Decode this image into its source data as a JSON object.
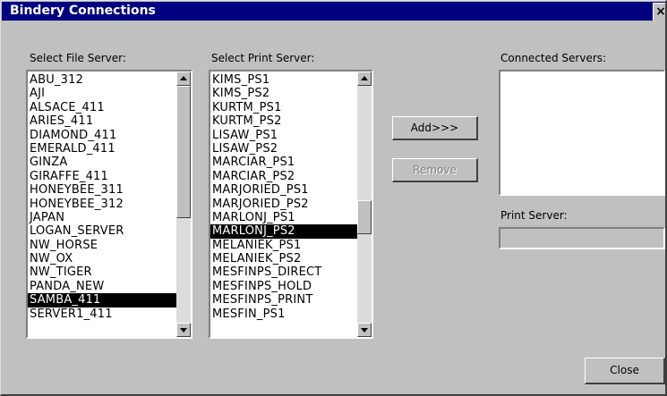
{
  "window": {
    "title": "Bindery Connections",
    "close_glyph": "×"
  },
  "file_server": {
    "label": "Select File Server:",
    "items": [
      "ABU_312",
      "AJI",
      "ALSACE_411",
      "ARIES_411",
      "DIAMOND_411",
      "EMERALD_411",
      "GINZA",
      "GIRAFFE_411",
      "HONEYBEE_311",
      "HONEYBEE_312",
      "JAPAN",
      "LOGAN_SERVER",
      "NW_HORSE",
      "NW_OX",
      "NW_TIGER",
      "PANDA_NEW",
      "SAMBA_411",
      "SERVER1_411"
    ],
    "selected": "SAMBA_411"
  },
  "print_server": {
    "label": "Select Print Server:",
    "items": [
      "KIMS_PS1",
      "KIMS_PS2",
      "KURTM_PS1",
      "KURTM_PS2",
      "LISAW_PS1",
      "LISAW_PS2",
      "MARCIAR_PS1",
      "MARCIAR_PS2",
      "MARJORIED_PS1",
      "MARJORIED_PS2",
      "MARLONJ_PS1",
      "MARLONJ_PS2",
      "MELANIEK_PS1",
      "MELANIEK_PS2",
      "MESFINPS_DIRECT",
      "MESFINPS_HOLD",
      "MESFINPS_PRINT",
      "MESFIN_PS1"
    ],
    "selected": "MARLONJ_PS2"
  },
  "buttons": {
    "add": "Add>>>",
    "remove": "Remove",
    "close": "Close"
  },
  "connected": {
    "label": "Connected Servers:",
    "items": []
  },
  "print_server_field": {
    "label": "Print Server:",
    "value": ""
  }
}
